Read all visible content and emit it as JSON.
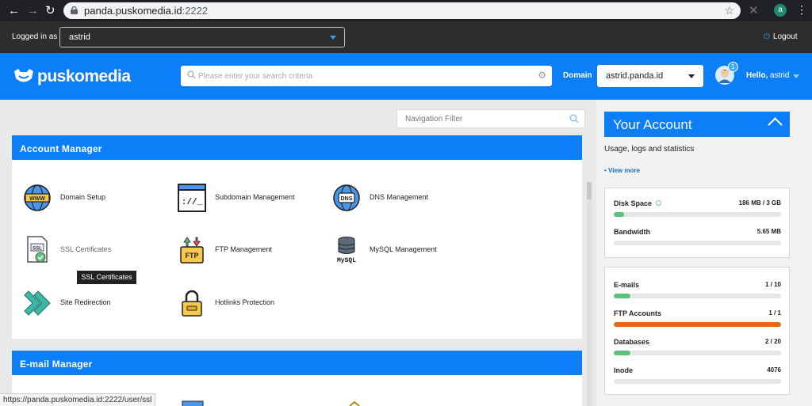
{
  "browser": {
    "url_host": "panda.puskomedia.id",
    "url_port": ":2222",
    "profile_initial": "a"
  },
  "userbar": {
    "logged_in_label": "Logged in as",
    "user": "astrid",
    "logout_label": "Logout"
  },
  "header": {
    "logo_text": "puskomedia",
    "search_placeholder": "Please enter your search criteria",
    "domain_label": "Domain",
    "domain_value": "astrid.panda.id",
    "notification_count": "1",
    "hello_prefix": "Hello,",
    "hello_user": "astrid"
  },
  "main": {
    "nav_filter_placeholder": "Navigation Filter",
    "account_manager": {
      "title": "Account Manager",
      "tools": [
        {
          "label": "Domain Setup"
        },
        {
          "label": "Subdomain Management"
        },
        {
          "label": "DNS Management"
        },
        {
          "label": "SSL Certificates"
        },
        {
          "label": "FTP Management"
        },
        {
          "label": "MySQL Management"
        },
        {
          "label": "Site Redirection"
        },
        {
          "label": "Hotlinks Protection"
        }
      ]
    },
    "email_manager": {
      "title": "E-mail Manager"
    },
    "tooltip": "SSL Certificates",
    "status_url": "https://panda.puskomedia.id:2222/user/ssl"
  },
  "account": {
    "title": "Your Account",
    "subtitle": "Usage, logs and statistics",
    "view_more": "• View more",
    "usage": [
      {
        "name": "Disk Space",
        "value": "186 MB / 3 GB",
        "percent": 6,
        "color": "#5cc27a"
      },
      {
        "name": "Bandwidth",
        "value": "5.65 MB",
        "percent": 0,
        "color": "#5cc27a"
      }
    ],
    "limits": [
      {
        "name": "E-mails",
        "value": "1 / 10",
        "percent": 10,
        "color": "#5cc27a"
      },
      {
        "name": "FTP Accounts",
        "value": "1 / 1",
        "percent": 100,
        "color": "#f0650e"
      },
      {
        "name": "Databases",
        "value": "2 / 20",
        "percent": 10,
        "color": "#5cc27a"
      },
      {
        "name": "Inode",
        "value": "4076",
        "percent": 0,
        "color": "#5cc27a"
      }
    ]
  },
  "colors": {
    "brand_blue": "#0c7ef8",
    "ok_green": "#5cc27a",
    "full_orange": "#f0650e"
  }
}
